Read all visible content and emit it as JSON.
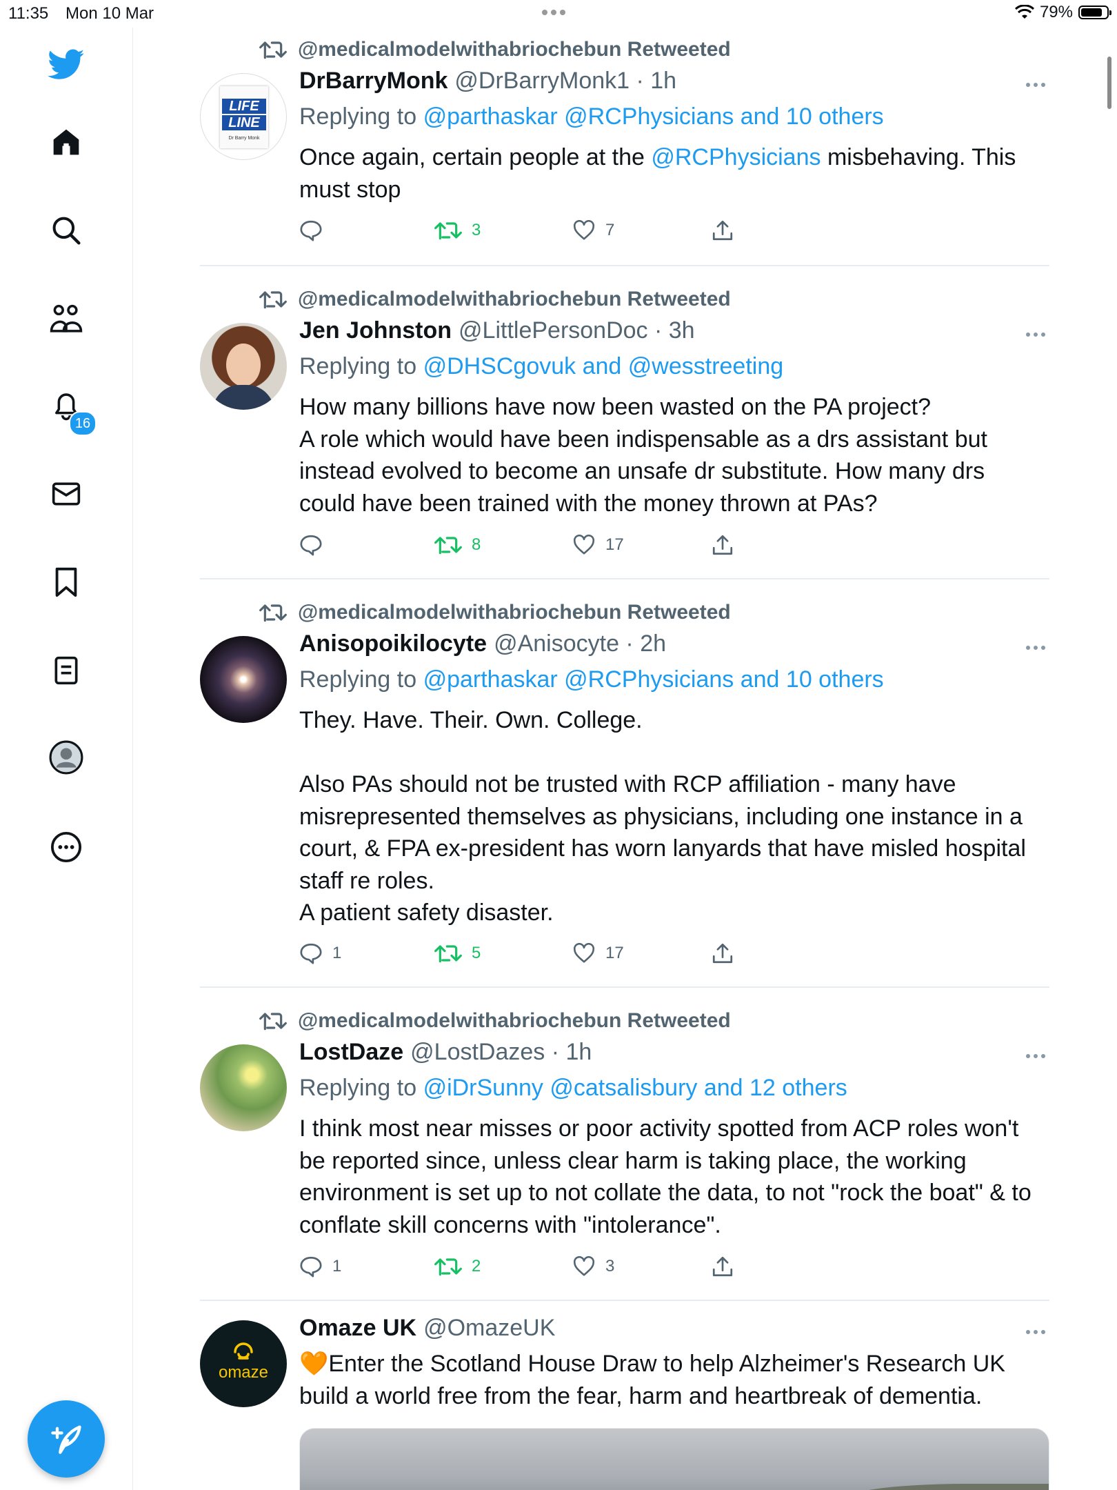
{
  "status_bar": {
    "time": "11:35",
    "date": "Mon 10 Mar",
    "battery": "79%"
  },
  "sidebar": {
    "notifications_badge": "16",
    "items": [
      "home-icon",
      "search-icon",
      "communities-icon",
      "notifications-icon",
      "messages-icon",
      "bookmarks-icon",
      "lists-icon",
      "profile-icon",
      "more-icon"
    ]
  },
  "colors": {
    "accent": "#1d9bf0",
    "retweet": "#17bf63",
    "secondary_text": "#536471"
  },
  "tweets": [
    {
      "retweeted_by": "@medicalmodelwithabriochebun Retweeted",
      "name": "DrBarryMonk",
      "handle": "@DrBarryMonk1 · 1h",
      "avatar_text": [
        "LIFE",
        "LINE",
        "Dr Barry Monk"
      ],
      "replying_prefix": "Replying to",
      "replying_to": "@parthaskar @RCPhysicians and 10 others",
      "body_before": "Once again, certain people at the ",
      "body_mention": "@RCPhysicians",
      "body_after": " misbehaving. This must stop",
      "replies": "",
      "retweets": "3",
      "likes": "7"
    },
    {
      "retweeted_by": "@medicalmodelwithabriochebun Retweeted",
      "name": "Jen Johnston",
      "handle": "@LittlePersonDoc · 3h",
      "replying_prefix": "Replying to",
      "replying_to": "@DHSCgovuk and @wesstreeting",
      "body_lines": [
        "How many billions have now been wasted on the PA project?",
        "A role which would have been indispensable as a drs assistant but instead evolved to become an unsafe dr substitute. How many drs could have been trained with the money thrown at PAs?"
      ],
      "replies": "",
      "retweets": "8",
      "likes": "17"
    },
    {
      "retweeted_by": "@medicalmodelwithabriochebun Retweeted",
      "name": "Anisopoikilocyte",
      "handle": "@Anisocyte · 2h",
      "replying_prefix": "Replying to",
      "replying_to": "@parthaskar @RCPhysicians and 10 others",
      "body_lines": [
        "They. Have. Their. Own. College.",
        "",
        "Also PAs should not be trusted with RCP affiliation - many have misrepresented themselves as physicians, including one instance in a court, & FPA ex-president has worn lanyards that have misled hospital staff re roles.",
        "A patient safety disaster."
      ],
      "replies": "1",
      "retweets": "5",
      "likes": "17"
    },
    {
      "retweeted_by": "@medicalmodelwithabriochebun Retweeted",
      "name": "LostDaze",
      "handle": "@LostDazes · 1h",
      "replying_prefix": "Replying to",
      "replying_to": "@iDrSunny @catsalisbury and 12 others",
      "body_lines": [
        "I think most near misses or poor activity spotted from ACP roles won't be reported since, unless clear harm is taking place, the working environment is set up to not collate the data, to not \"rock the boat\" & to conflate skill concerns with \"intolerance\"."
      ],
      "replies": "1",
      "retweets": "2",
      "likes": "3"
    },
    {
      "name": "Omaze UK",
      "handle": "@OmazeUK",
      "avatar_text": "omaze",
      "body_emoji": "🧡",
      "body_lines": [
        "Enter the Scotland House Draw to help Alzheimer's Research UK build a world free from the fear, harm and heartbreak of dementia."
      ]
    }
  ]
}
